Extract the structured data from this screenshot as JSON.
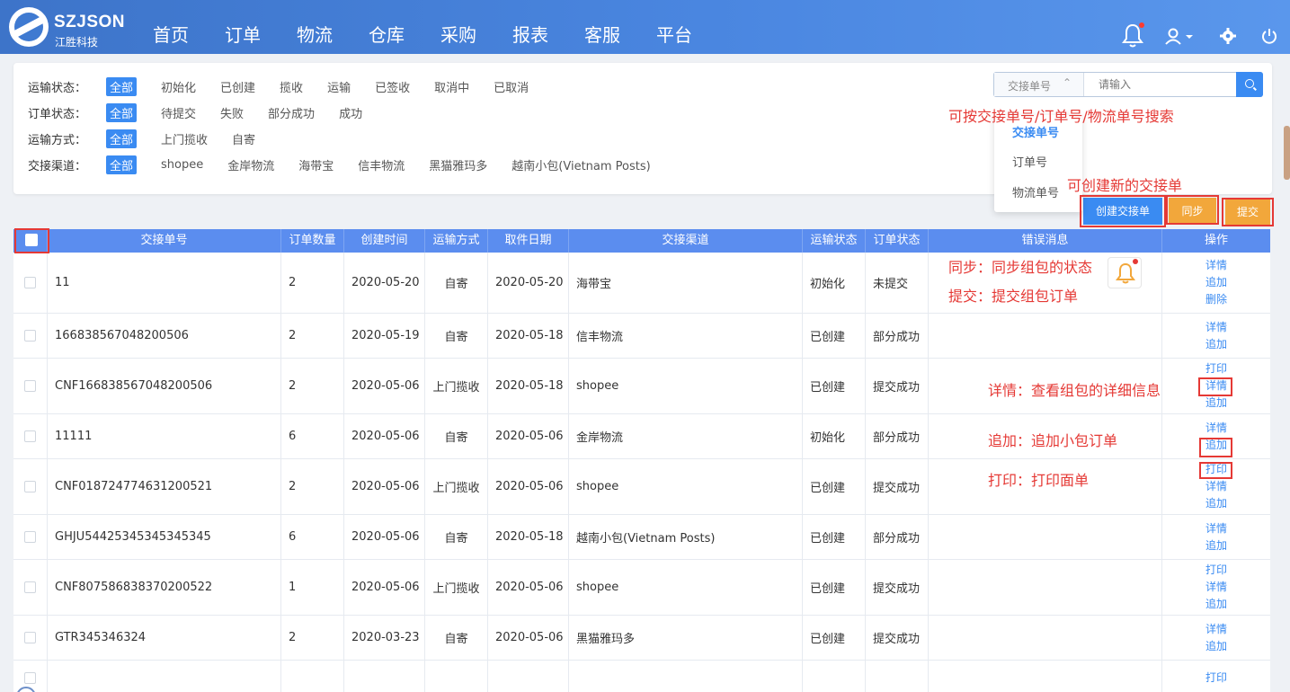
{
  "brand": {
    "name": "SZJSON",
    "sub": "江胜科技"
  },
  "nav": [
    "首页",
    "订单",
    "物流",
    "仓库",
    "采购",
    "报表",
    "客服",
    "平台"
  ],
  "filters": [
    {
      "label": "运输状态：",
      "options": [
        "全部",
        "初始化",
        "已创建",
        "揽收",
        "运输",
        "已签收",
        "取消中",
        "已取消"
      ]
    },
    {
      "label": "订单状态：",
      "options": [
        "全部",
        "待提交",
        "失败",
        "部分成功",
        "成功"
      ]
    },
    {
      "label": "运输方式：",
      "options": [
        "全部",
        "上门揽收",
        "自寄"
      ]
    },
    {
      "label": "交接渠道：",
      "options": [
        "全部",
        "shopee",
        "金岸物流",
        "海带宝",
        "信丰物流",
        "黑猫雅玛多",
        "越南小包(Vietnam Posts)"
      ]
    }
  ],
  "search": {
    "type": "交接单号",
    "placeholder": "请输入"
  },
  "dropdown": [
    "交接单号",
    "订单号",
    "物流单号"
  ],
  "buttons": {
    "create": "创建交接单",
    "sync": "同步",
    "submit": "提交"
  },
  "table": {
    "headers": [
      "交接单号",
      "订单数量",
      "创建时间",
      "运输方式",
      "取件日期",
      "交接渠道",
      "运输状态",
      "订单状态",
      "错误消息",
      "操作"
    ],
    "rows": [
      {
        "id": "11",
        "qty": "2",
        "created": "2020-05-20",
        "method": "自寄",
        "pickup": "2020-05-20",
        "channel": "海带宝",
        "ship": "初始化",
        "order": "未提交",
        "ops": [
          "详情",
          "追加",
          "删除"
        ]
      },
      {
        "id": "166838567048200506",
        "qty": "2",
        "created": "2020-05-19",
        "method": "自寄",
        "pickup": "2020-05-18",
        "channel": "信丰物流",
        "ship": "已创建",
        "order": "部分成功",
        "ops": [
          "详情",
          "追加"
        ]
      },
      {
        "id": "CNF166838567048200506",
        "qty": "2",
        "created": "2020-05-06",
        "method": "上门揽收",
        "pickup": "2020-05-18",
        "channel": "shopee",
        "ship": "已创建",
        "order": "提交成功",
        "ops": [
          "打印",
          "详情",
          "追加"
        ]
      },
      {
        "id": "11111",
        "qty": "6",
        "created": "2020-05-06",
        "method": "自寄",
        "pickup": "2020-05-06",
        "channel": "金岸物流",
        "ship": "初始化",
        "order": "部分成功",
        "ops": [
          "详情",
          "追加"
        ]
      },
      {
        "id": "CNF018724774631200521",
        "qty": "2",
        "created": "2020-05-06",
        "method": "上门揽收",
        "pickup": "2020-05-06",
        "channel": "shopee",
        "ship": "已创建",
        "order": "提交成功",
        "ops": [
          "打印",
          "详情",
          "追加"
        ]
      },
      {
        "id": "GHJU54425345345345345",
        "qty": "6",
        "created": "2020-05-06",
        "method": "自寄",
        "pickup": "2020-05-18",
        "channel": "越南小包(Vietnam Posts)",
        "ship": "已创建",
        "order": "部分成功",
        "ops": [
          "详情",
          "追加"
        ]
      },
      {
        "id": "CNF807586838370200522",
        "qty": "1",
        "created": "2020-05-06",
        "method": "上门揽收",
        "pickup": "2020-05-06",
        "channel": "shopee",
        "ship": "已创建",
        "order": "提交成功",
        "ops": [
          "打印",
          "详情",
          "追加"
        ]
      },
      {
        "id": "GTR345346324",
        "qty": "2",
        "created": "2020-03-23",
        "method": "自寄",
        "pickup": "2020-05-06",
        "channel": "黑猫雅玛多",
        "ship": "已创建",
        "order": "提交成功",
        "ops": [
          "详情",
          "追加"
        ]
      },
      {
        "id": "",
        "qty": "",
        "created": "",
        "method": "",
        "pickup": "",
        "channel": "",
        "ship": "",
        "order": "",
        "ops": [
          "打印"
        ]
      }
    ]
  },
  "annotations": {
    "search_tip": "可按交接单号/订单号/物流单号搜索",
    "create_tip": "可创建新的交接单",
    "sync_tip": "同步：同步组包的状态",
    "submit_tip": "提交：提交组包订单",
    "detail_tip": "详情：查看组包的详细信息",
    "append_tip": "追加：追加小包订单",
    "print_tip": "打印：打印面单"
  },
  "colors": {
    "header": "#4a86e0",
    "accent": "#3a8bf2",
    "orange": "#f2a73b",
    "annotation": "#e53935"
  }
}
